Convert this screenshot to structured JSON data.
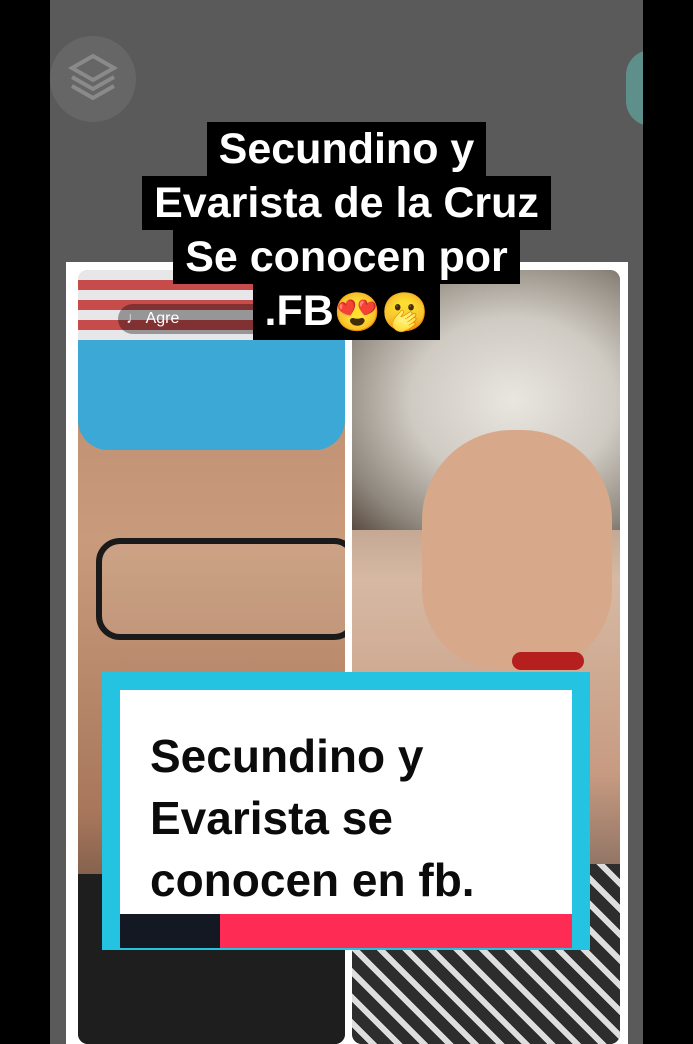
{
  "overlay": {
    "title_lines": [
      "Secundino y",
      "Evarista de la Cruz",
      "Se conocen por",
      ".FB"
    ],
    "title_emojis": "😍🫢"
  },
  "video": {
    "music_label": "♩ Agre"
  },
  "caption": {
    "lines": [
      "Secundino y",
      "Evarista se",
      "conocen en fb."
    ]
  },
  "icons": {
    "layers": "layers-icon"
  },
  "colors": {
    "accent_cyan": "#24c3e1",
    "accent_pink": "#fe2c55",
    "dark_bar": "#141823"
  }
}
